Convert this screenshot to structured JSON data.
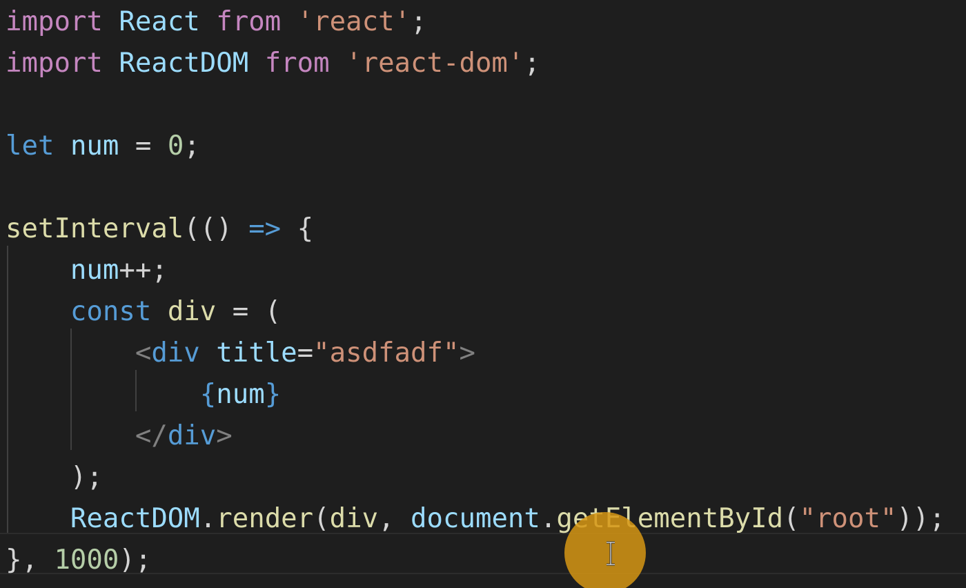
{
  "editor": {
    "theme_colors": {
      "background": "#1e1e1e",
      "keyword_control": "#c586c0",
      "keyword_storage": "#569cd6",
      "variable": "#9cdcfe",
      "function": "#dcdcaa",
      "string": "#ce9178",
      "number": "#b5cea8",
      "punctuation": "#d4d4d4",
      "tag_bracket": "#808080",
      "cursor_highlight": "#d69614"
    },
    "lines": [
      {
        "tokens": [
          {
            "t": "import",
            "c": "#c586c0"
          },
          {
            "t": " ",
            "c": "#d4d4d4"
          },
          {
            "t": "React",
            "c": "#9cdcfe"
          },
          {
            "t": " ",
            "c": "#d4d4d4"
          },
          {
            "t": "from",
            "c": "#c586c0"
          },
          {
            "t": " ",
            "c": "#d4d4d4"
          },
          {
            "t": "'react'",
            "c": "#ce9178"
          },
          {
            "t": ";",
            "c": "#d4d4d4"
          }
        ]
      },
      {
        "tokens": [
          {
            "t": "import",
            "c": "#c586c0"
          },
          {
            "t": " ",
            "c": "#d4d4d4"
          },
          {
            "t": "ReactDOM",
            "c": "#9cdcfe"
          },
          {
            "t": " ",
            "c": "#d4d4d4"
          },
          {
            "t": "from",
            "c": "#c586c0"
          },
          {
            "t": " ",
            "c": "#d4d4d4"
          },
          {
            "t": "'react-dom'",
            "c": "#ce9178"
          },
          {
            "t": ";",
            "c": "#d4d4d4"
          }
        ]
      },
      {
        "tokens": []
      },
      {
        "tokens": [
          {
            "t": "let",
            "c": "#569cd6"
          },
          {
            "t": " ",
            "c": "#d4d4d4"
          },
          {
            "t": "num",
            "c": "#9cdcfe"
          },
          {
            "t": " = ",
            "c": "#d4d4d4"
          },
          {
            "t": "0",
            "c": "#b5cea8"
          },
          {
            "t": ";",
            "c": "#d4d4d4"
          }
        ]
      },
      {
        "tokens": []
      },
      {
        "tokens": [
          {
            "t": "setInterval",
            "c": "#dcdcaa"
          },
          {
            "t": "(() ",
            "c": "#d4d4d4"
          },
          {
            "t": "=>",
            "c": "#569cd6"
          },
          {
            "t": " {",
            "c": "#d4d4d4"
          }
        ]
      },
      {
        "tokens": [
          {
            "t": "    ",
            "c": "#d4d4d4"
          },
          {
            "t": "num",
            "c": "#9cdcfe"
          },
          {
            "t": "++;",
            "c": "#d4d4d4"
          }
        ]
      },
      {
        "tokens": [
          {
            "t": "    ",
            "c": "#d4d4d4"
          },
          {
            "t": "const",
            "c": "#569cd6"
          },
          {
            "t": " ",
            "c": "#d4d4d4"
          },
          {
            "t": "div",
            "c": "#dcdcaa"
          },
          {
            "t": " = (",
            "c": "#d4d4d4"
          }
        ]
      },
      {
        "tokens": [
          {
            "t": "        ",
            "c": "#d4d4d4"
          },
          {
            "t": "<",
            "c": "#808080"
          },
          {
            "t": "div",
            "c": "#569cd6"
          },
          {
            "t": " ",
            "c": "#d4d4d4"
          },
          {
            "t": "title",
            "c": "#9cdcfe"
          },
          {
            "t": "=",
            "c": "#d4d4d4"
          },
          {
            "t": "\"asdfadf\"",
            "c": "#ce9178"
          },
          {
            "t": ">",
            "c": "#808080"
          }
        ]
      },
      {
        "tokens": [
          {
            "t": "            ",
            "c": "#d4d4d4"
          },
          {
            "t": "{",
            "c": "#569cd6"
          },
          {
            "t": "num",
            "c": "#9cdcfe"
          },
          {
            "t": "}",
            "c": "#569cd6"
          }
        ]
      },
      {
        "tokens": [
          {
            "t": "        ",
            "c": "#d4d4d4"
          },
          {
            "t": "</",
            "c": "#808080"
          },
          {
            "t": "div",
            "c": "#569cd6"
          },
          {
            "t": ">",
            "c": "#808080"
          }
        ]
      },
      {
        "tokens": [
          {
            "t": "    ",
            "c": "#d4d4d4"
          },
          {
            "t": ");",
            "c": "#d4d4d4"
          }
        ]
      },
      {
        "tokens": [
          {
            "t": "    ",
            "c": "#d4d4d4"
          },
          {
            "t": "ReactDOM",
            "c": "#9cdcfe"
          },
          {
            "t": ".",
            "c": "#d4d4d4"
          },
          {
            "t": "render",
            "c": "#dcdcaa"
          },
          {
            "t": "(",
            "c": "#d4d4d4"
          },
          {
            "t": "div",
            "c": "#dcdcaa"
          },
          {
            "t": ", ",
            "c": "#d4d4d4"
          },
          {
            "t": "document",
            "c": "#9cdcfe"
          },
          {
            "t": ".",
            "c": "#d4d4d4"
          },
          {
            "t": "getElementById",
            "c": "#dcdcaa"
          },
          {
            "t": "(",
            "c": "#d4d4d4"
          },
          {
            "t": "\"root\"",
            "c": "#ce9178"
          },
          {
            "t": "));",
            "c": "#d4d4d4"
          }
        ]
      },
      {
        "tokens": [
          {
            "t": "}, ",
            "c": "#d4d4d4"
          },
          {
            "t": "1000",
            "c": "#b5cea8"
          },
          {
            "t": ");",
            "c": "#d4d4d4"
          }
        ]
      }
    ]
  }
}
